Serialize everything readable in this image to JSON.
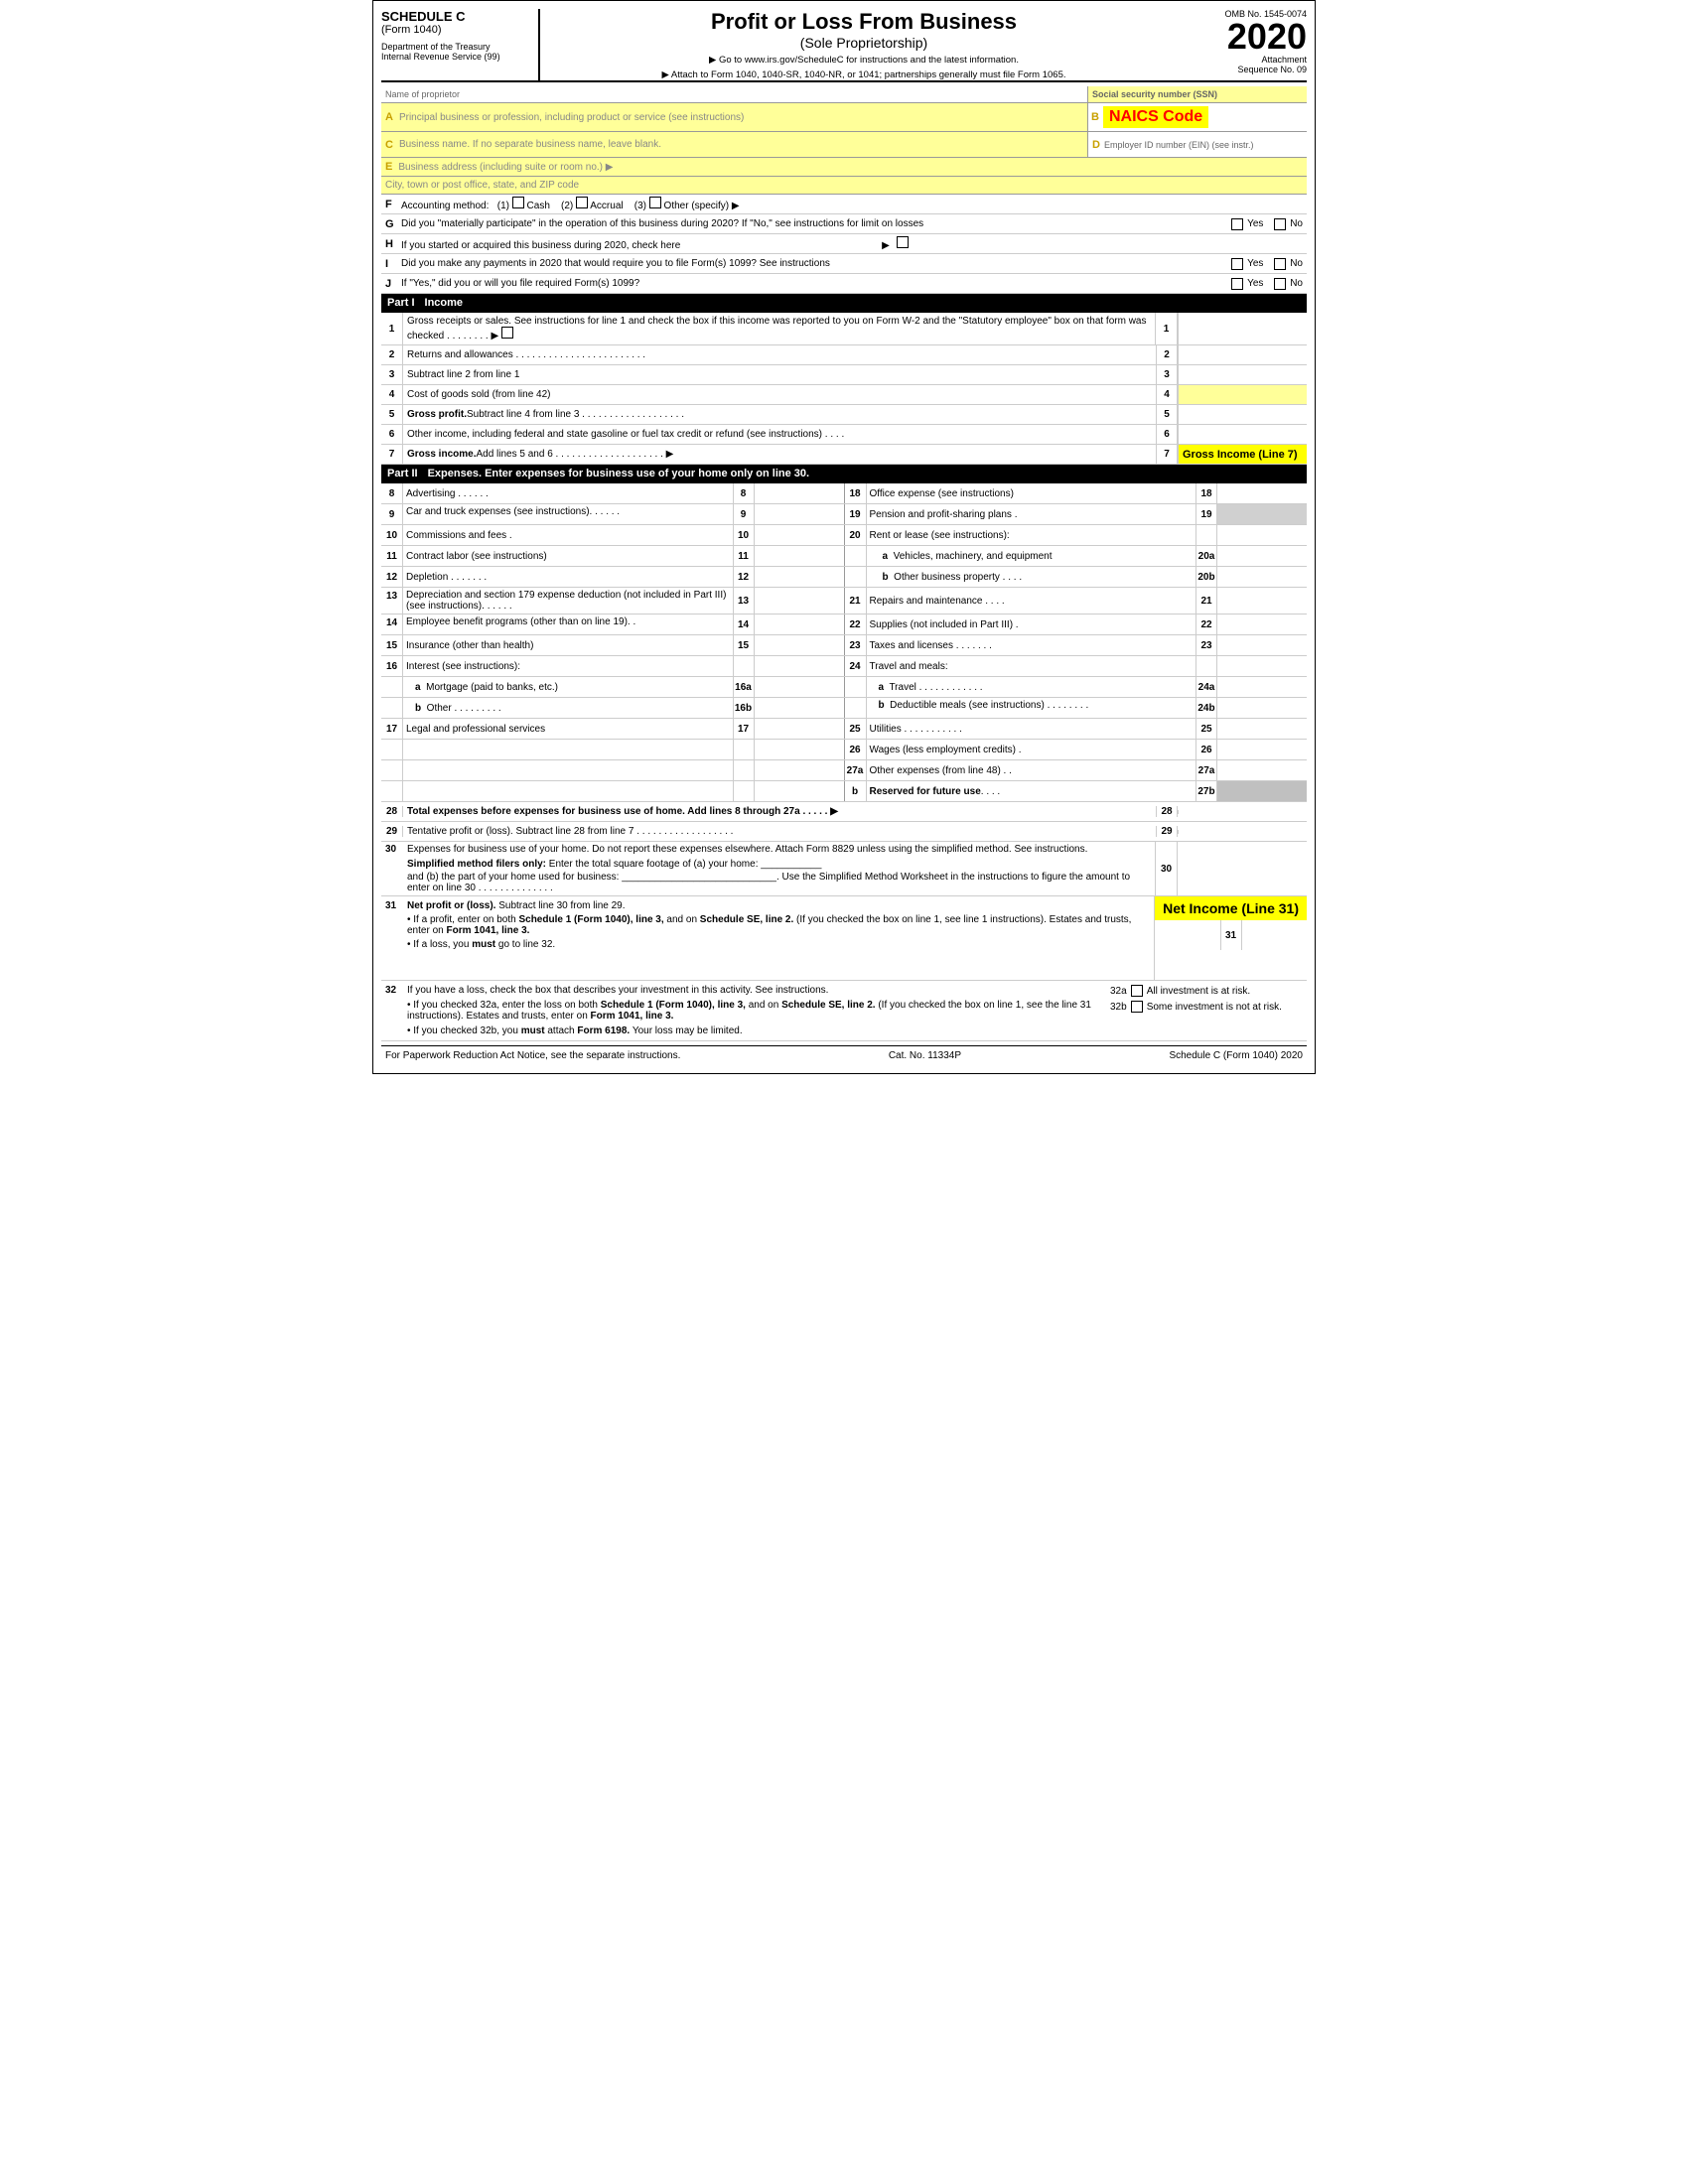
{
  "header": {
    "schedule_c": "SCHEDULE C",
    "form_1040": "(Form 1040)",
    "dept": "Department of the Treasury",
    "irs": "Internal Revenue Service (99)",
    "main_title": "Profit or Loss From Business",
    "sub_title": "(Sole Proprietorship)",
    "instruction1": "▶ Go to www.irs.gov/ScheduleC for instructions and the latest information.",
    "instruction2": "▶ Attach to Form 1040, 1040-SR, 1040-NR, or 1041; partnerships generally must file Form 1065.",
    "omb": "OMB No. 1545-0074",
    "year": "2020",
    "attachment": "Attachment",
    "sequence": "Sequence No. 09"
  },
  "fields": {
    "name_label": "Name of proprietor",
    "ssn_label": "Social security number (SSN)",
    "a_label": "A",
    "a_text": "Principal business or profession, including product or service (see instructions)",
    "b_label": "B",
    "naics": "NAICS Code",
    "c_label": "C",
    "c_text": "Business name. If no separate business name, leave blank.",
    "d_label": "D",
    "d_text": "Employer ID number (EIN) (see instr.)",
    "e_label": "E",
    "e_text": "Business address (including suite or room no.) ▶",
    "city_text": "City, town or post office, state, and ZIP code",
    "f_label": "F",
    "f_text": "Accounting method:",
    "f_1": "(1)",
    "f_cash": "Cash",
    "f_2": "(2)",
    "f_accrual": "Accrual",
    "f_3": "(3)",
    "f_other": "Other (specify) ▶",
    "g_label": "G",
    "g_text": "Did you \"materially participate\" in the operation of this business during 2020? If \"No,\" see instructions for limit on losses",
    "g_yes": "Yes",
    "g_no": "No",
    "h_label": "H",
    "h_text": "If you started or acquired this business during 2020, check here",
    "h_arrow": "▶",
    "i_label": "I",
    "i_text": "Did you make any payments in 2020 that would require you to file Form(s) 1099? See instructions",
    "i_yes": "Yes",
    "i_no": "No",
    "j_label": "J",
    "j_text": "If \"Yes,\" did you or will you file required Form(s) 1099?",
    "j_yes": "Yes",
    "j_no": "No"
  },
  "part1": {
    "label": "Part I",
    "title": "Income",
    "lines": [
      {
        "num": "1",
        "text": "Gross receipts or sales. See instructions for line 1 and check the box if this income was reported to you on Form W-2 and the \"Statutory employee\" box on that form was checked . . . . . . . . ▶ □",
        "amount": ""
      },
      {
        "num": "2",
        "text": "Returns and allowances . . . . . . . . . . . . . . . . . . . . . . . .",
        "amount": ""
      },
      {
        "num": "3",
        "text": "Subtract line 2 from line 1",
        "amount": ""
      },
      {
        "num": "4",
        "text": "Cost of goods sold (from line 42)",
        "amount": ""
      },
      {
        "num": "5",
        "text": "Gross profit. Subtract line 4 from line 3 . . . . . . . . . . . . . . . . . . .",
        "amount": ""
      },
      {
        "num": "6",
        "text": "Other income, including federal and state gasoline or fuel tax credit or refund (see instructions) . . . .",
        "amount": ""
      },
      {
        "num": "7",
        "text": "Gross income. Add lines 5 and 6 . . . . . . . . . . . . . . . . . . . . ▶",
        "amount": "Gross Income (Line 7)",
        "highlight": true
      }
    ]
  },
  "part2": {
    "label": "Part II",
    "title": "Expenses.",
    "title_suffix": "Enter expenses for business use of your home only on line 30.",
    "left_lines": [
      {
        "num": "8",
        "label": "8",
        "text": "Advertising . . . . . ."
      },
      {
        "num": "9",
        "label": "9",
        "text": "Car and truck expenses (see instructions). . . . . ."
      },
      {
        "num": "10",
        "label": "10",
        "text": "Commissions and fees ."
      },
      {
        "num": "11",
        "label": "11",
        "text": "Contract labor (see instructions)"
      },
      {
        "num": "12",
        "label": "12",
        "text": "Depletion . . . . . . ."
      },
      {
        "num": "13",
        "label": "13",
        "text": "Depreciation and section 179 expense deduction (not included in Part III) (see instructions). . . . . ."
      },
      {
        "num": "14",
        "label": "14",
        "text": "Employee benefit programs (other than on line 19). ."
      },
      {
        "num": "15",
        "label": "15",
        "text": "Insurance (other than health)"
      },
      {
        "num": "16a",
        "label": "16a",
        "text": "Mortgage (paid to banks, etc.)"
      },
      {
        "num": "16b",
        "label": "16b",
        "text": "Other . . . . . . . . ."
      },
      {
        "num": "17",
        "label": "17",
        "text": "Legal and professional services"
      }
    ],
    "right_lines": [
      {
        "num": "18",
        "label": "18",
        "text": "Office expense (see instructions)"
      },
      {
        "num": "19",
        "label": "19",
        "text": "Pension and profit-sharing plans ."
      },
      {
        "num": "20a",
        "label": "20a",
        "text": "Vehicles, machinery, and equipment"
      },
      {
        "num": "20b",
        "label": "20b",
        "text": "Other business property . . . ."
      },
      {
        "num": "21",
        "label": "21",
        "text": "Repairs and maintenance . . . ."
      },
      {
        "num": "22",
        "label": "22",
        "text": "Supplies (not included in Part III) ."
      },
      {
        "num": "23",
        "label": "23",
        "text": "Taxes and licenses . . . . . . ."
      },
      {
        "num": "24a",
        "label": "24a",
        "text": "Travel . . . . . . . . . . . ."
      },
      {
        "num": "24b",
        "label": "24b",
        "text": "Deductible meals (see instructions) . . . . . . . ."
      },
      {
        "num": "25",
        "label": "25",
        "text": "Utilities . . . . . . . . . . ."
      },
      {
        "num": "26",
        "label": "26",
        "text": "Wages (less employment credits) ."
      },
      {
        "num": "27a",
        "label": "27a",
        "text": "Other expenses (from line 48) . ."
      },
      {
        "num": "27b",
        "label": "27b",
        "text": "Reserved for future use . . . ."
      }
    ],
    "rent_label": "20",
    "rent_text": "Rent or lease (see instructions):",
    "travel_label": "24",
    "travel_text": "Travel and meals:",
    "line16_label": "16",
    "line16_text": "Interest (see instructions):",
    "line24_label": "b",
    "line24b_text": "Deductible meals (see instructions).",
    "line27b_text": "Reserved for future use . . . ."
  },
  "summary_lines": [
    {
      "num": "28",
      "text": "Total expenses before expenses for business use of home. Add lines 8 through 27a . . . . . ▶",
      "bold": true
    },
    {
      "num": "29",
      "text": "Tentative profit or (loss). Subtract line 28 from line 7 . . . . . . . . . . . . . . . . . ."
    }
  ],
  "line30": {
    "num": "30",
    "text1": "Expenses for business use of your home. Do not report these expenses elsewhere. Attach Form 8829 unless using the simplified method. See instructions.",
    "text2": "Simplified method filers only: Enter the total square footage of (a) your home:",
    "text3": "and (b) the part of your home used for business:",
    "text4": ". Use the Simplified Method Worksheet in the instructions to figure the amount to enter on line 30 . . . . . . . . . . . . . ."
  },
  "line31": {
    "num": "31",
    "text": "Net profit or (loss). Subtract line 30 from line 29.",
    "bullet1": "• If a profit, enter on both Schedule 1 (Form 1040), line 3, and on Schedule SE, line 2. (If you checked the box on line 1, see line 1 instructions). Estates and trusts, enter on Form 1041, line 3.",
    "bullet2": "• If a loss, you must go to line 32.",
    "highlight_label": "Net Income (Line 31)"
  },
  "line32": {
    "num": "32",
    "text": "If you have a loss, check the box that describes your investment in this activity. See instructions.",
    "bullet1": "• If you checked 32a, enter the loss on both Schedule 1 (Form 1040), line 3, and on Schedule SE, line 2. (If you checked the box on line 1, see the line 31 instructions). Estates and trusts, enter on Form 1041, line 3.",
    "bullet2": "• If you checked 32b, you must attach Form 6198. Your loss may be limited.",
    "checkbox_32a": "32a",
    "text_32a": "All investment is at risk.",
    "checkbox_32b": "32b",
    "text_32b": "Some investment is not at risk."
  },
  "footer": {
    "left": "For Paperwork Reduction Act Notice, see the separate instructions.",
    "center": "Cat. No. 11334P",
    "right": "Schedule C (Form 1040) 2020"
  }
}
